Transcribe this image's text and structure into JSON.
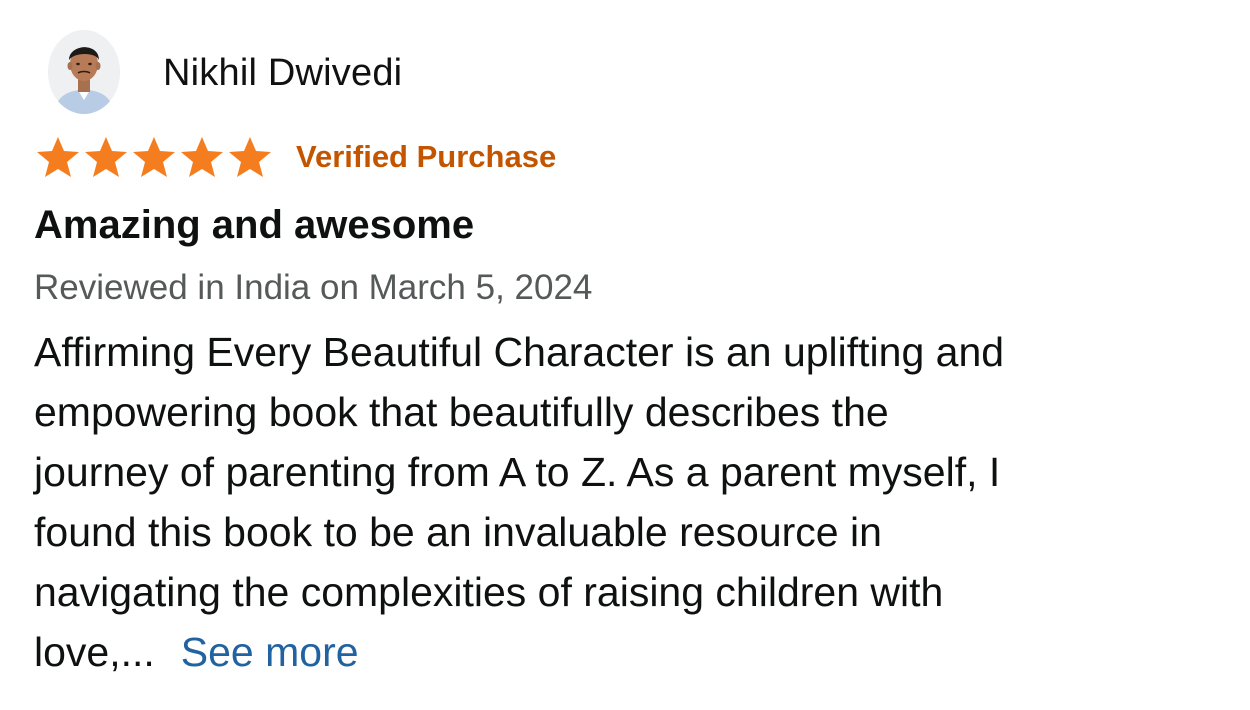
{
  "reviewer": {
    "name": "Nikhil Dwivedi",
    "avatar_icon": "person-avatar-icon"
  },
  "rating": {
    "stars": 5,
    "max_stars": 5,
    "star_color": "#f47e1f",
    "badge": "Verified Purchase",
    "badge_color": "#c45500"
  },
  "review": {
    "title": "Amazing and awesome",
    "date_line": "Reviewed in India on March 5, 2024",
    "body_lines": [
      "Affirming Every Beautiful Character is an uplifting and",
      "empowering book that beautifully describes the",
      "journey of parenting from A to Z. As a parent myself, I",
      "found this book to be an invaluable resource in",
      "navigating the complexities of raising children with",
      "love,..."
    ],
    "see_more_label": "See more",
    "link_color": "#2162a1"
  }
}
